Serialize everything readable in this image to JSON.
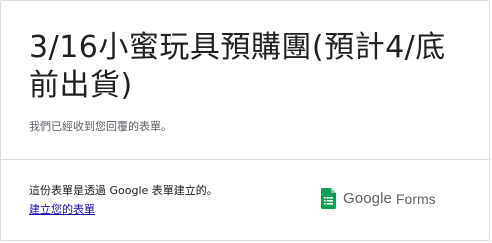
{
  "form": {
    "title": "3/16小蜜玩具預購團(預計4/底前出貨)",
    "confirmation_message": "我們已經收到您回覆的表單。"
  },
  "footer": {
    "created_with_text": "這份表單是透過 Google 表單建立的。",
    "create_link_label": "建立您的表單",
    "brand_google": "Google",
    "brand_forms": "Forms",
    "brand_icon": "google-forms-icon"
  },
  "colors": {
    "forms_green": "#0f9d58",
    "link_blue": "#1a0dab",
    "divider": "#dadce0"
  }
}
